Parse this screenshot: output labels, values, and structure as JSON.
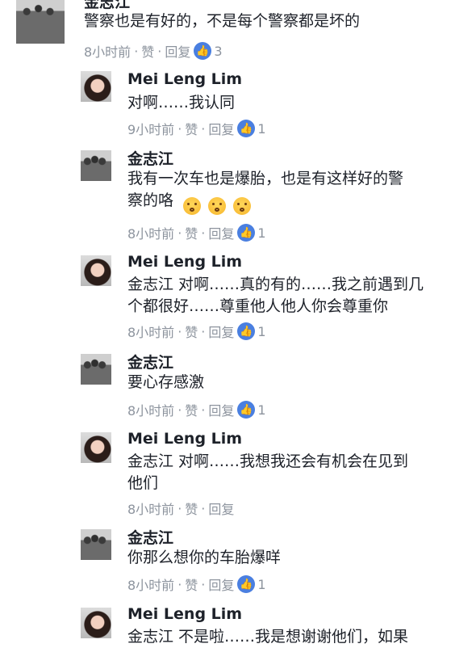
{
  "actions": {
    "like": "赞",
    "reply": "回复",
    "dot": "·"
  },
  "comments": [
    {
      "author": "金志江",
      "text": "警察也是有好的，不是每个警察都是坏的",
      "time": "8小时前",
      "likes": "3"
    },
    {
      "author": "Mei Leng Lim",
      "text": "对啊……我认同",
      "time": "9小时前",
      "likes": "1"
    },
    {
      "author": "金志江",
      "text": "我有一次车也是爆胎，也是有这样好的警\n察的咯",
      "time": "8小时前",
      "likes": "1"
    },
    {
      "author": "Mei Leng Lim",
      "text": "金志江 对啊……真的有的……我之前遇到几\n个都很好……尊重他人他人你会尊重你",
      "time": "8小时前",
      "likes": "1"
    },
    {
      "author": "金志江",
      "text": "要心存感激",
      "time": "8小时前",
      "likes": "1"
    },
    {
      "author": "Mei Leng Lim",
      "text": "金志江 对啊……我想我还会有机会在见到\n他们",
      "time": "8小时前",
      "likes": ""
    },
    {
      "author": "金志江",
      "text": "你那么想你的车胎爆咩",
      "time": "8小时前",
      "likes": "1"
    },
    {
      "author": "Mei Leng Lim",
      "text": "金志江 不是啦……我是想谢谢他们，如果",
      "time": "",
      "likes": ""
    }
  ]
}
